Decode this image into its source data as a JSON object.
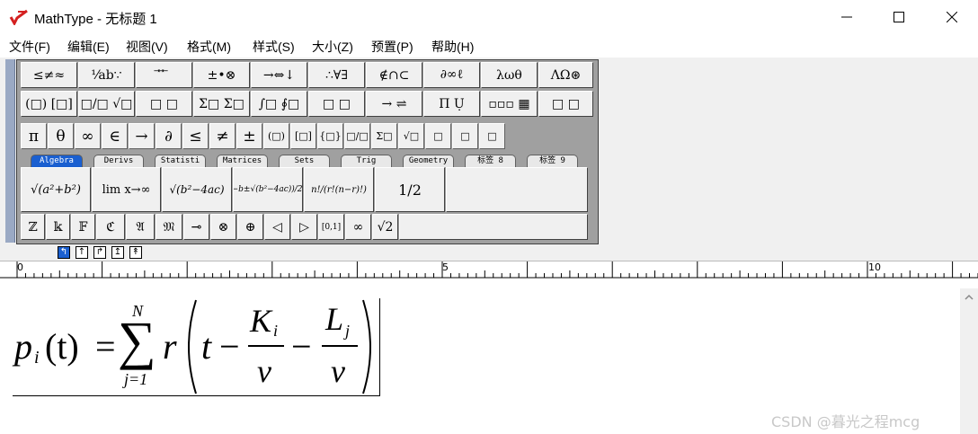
{
  "window": {
    "title": "MathType - 无标题 1",
    "accent_color": "#d42020"
  },
  "menu": [
    {
      "label": "文件(F)"
    },
    {
      "label": "编辑(E)"
    },
    {
      "label": "视图(V)"
    },
    {
      "label": "格式(M)"
    },
    {
      "label": "样式(S)"
    },
    {
      "label": "大小(Z)"
    },
    {
      "label": "预置(P)"
    },
    {
      "label": "帮助(H)"
    }
  ],
  "palette_row1": [
    "≤≠≈",
    "⅟ab∵",
    "⃗ ⃡ ⃖",
    "±•⊗",
    "→⇔↓",
    "∴∀∃",
    "∉∩⊂",
    "∂∞ℓ",
    "λωθ",
    "ΛΩ⊛"
  ],
  "palette_row2": [
    "(□) [□]",
    "□/□ √□",
    "□ □",
    "Σ□ Σ□",
    "∫□ ∮□",
    "□ □",
    "→ ⇌",
    "Π Ụ",
    "▫▫▫ ▦",
    "□ □"
  ],
  "symbols": [
    "π",
    "θ",
    "∞",
    "∈",
    "→",
    "∂",
    "≤",
    "≠",
    "±",
    "(□)",
    "[□]",
    "{□}",
    "□/□",
    "Σ□",
    "√□",
    "□",
    "□",
    "□"
  ],
  "tabs": [
    "Algebra",
    "Derivs",
    "Statisti",
    "Matrices",
    "Sets",
    "Trig",
    "Geometry",
    "标签 8",
    "标签 9"
  ],
  "templates": [
    {
      "label": "√(a²+b²)"
    },
    {
      "label": "lim x→∞"
    },
    {
      "label": "√(b²−4ac)"
    },
    {
      "label": "(−b±√(b²−4ac))/2a"
    },
    {
      "label": "n!/(r!(n−r)!)"
    },
    {
      "label": "1/2"
    }
  ],
  "small_symbols": [
    "ℤ",
    "𝕜",
    "𝔽",
    "ℭ",
    "𝔄",
    "𝔐",
    "⊸",
    "⊗",
    "⊕",
    "◁",
    "▷",
    "[0,1]",
    "∞",
    "√2"
  ],
  "nav_buttons": [
    "↰",
    "↑",
    "↱",
    "↥",
    "↟"
  ],
  "ruler": {
    "marks": [
      "0",
      "5",
      "10"
    ]
  },
  "formula": {
    "lhs": "p",
    "lhs_sub": "i",
    "lhs_arg": "(t)",
    "equals": "=",
    "sum_upper": "N",
    "sum_lower": "j=1",
    "sum_symbol": "∑",
    "r": "r",
    "t": "t",
    "minus1": "−",
    "K": "K",
    "K_sub": "i",
    "v1": "v",
    "minus2": "−",
    "L": "L",
    "L_sub": "j",
    "v2": "v"
  },
  "watermark": "CSDN @暮光之程mcg"
}
